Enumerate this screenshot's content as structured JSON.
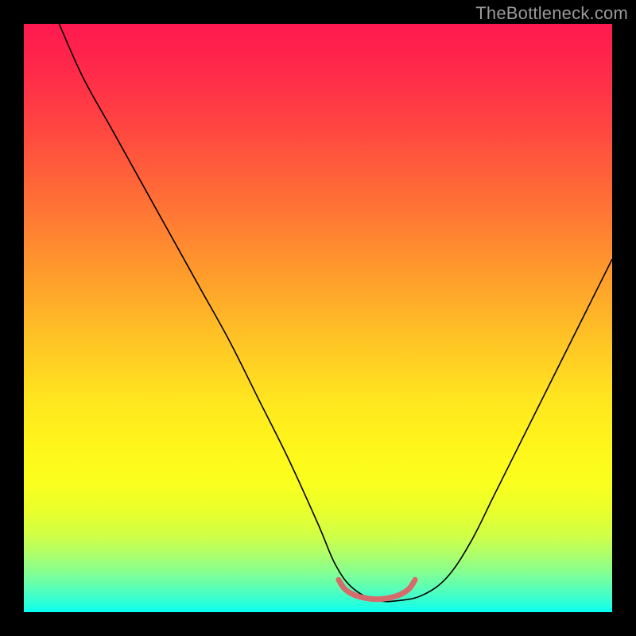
{
  "watermark": {
    "text": "TheBottleneck.com"
  },
  "chart_data": {
    "type": "line",
    "title": "",
    "xlabel": "",
    "ylabel": "",
    "xlim": [
      0,
      100
    ],
    "ylim": [
      0,
      100
    ],
    "background": {
      "type": "vertical-gradient",
      "stops": [
        {
          "pos": 0,
          "color": "#ff1950"
        },
        {
          "pos": 18,
          "color": "#ff4740"
        },
        {
          "pos": 42,
          "color": "#ff9a2c"
        },
        {
          "pos": 64,
          "color": "#ffe61f"
        },
        {
          "pos": 83,
          "color": "#e8ff2d"
        },
        {
          "pos": 93,
          "color": "#88ff8e"
        },
        {
          "pos": 100,
          "color": "#04fff4"
        }
      ]
    },
    "series": [
      {
        "name": "bottleneck-curve",
        "color": "#000000",
        "stroke_width": 1.6,
        "x": [
          6,
          10,
          15,
          20,
          25,
          30,
          35,
          40,
          45,
          50,
          53,
          56,
          60,
          64,
          68,
          72,
          76,
          80,
          85,
          90,
          95,
          100
        ],
        "values": [
          100,
          91,
          82,
          73,
          64,
          55,
          46,
          36,
          26,
          15,
          8,
          4,
          2,
          2,
          3,
          6,
          12,
          20,
          30,
          40,
          50,
          60
        ]
      },
      {
        "name": "optimal-marker",
        "color": "#d66b6b",
        "stroke_width": 7,
        "linecap": "round",
        "x": [
          53.5,
          54.5,
          56,
          58,
          60,
          62,
          64,
          65.5,
          66.5
        ],
        "values": [
          5.5,
          4.0,
          3.0,
          2.4,
          2.2,
          2.4,
          3.0,
          4.0,
          5.5
        ]
      }
    ]
  }
}
